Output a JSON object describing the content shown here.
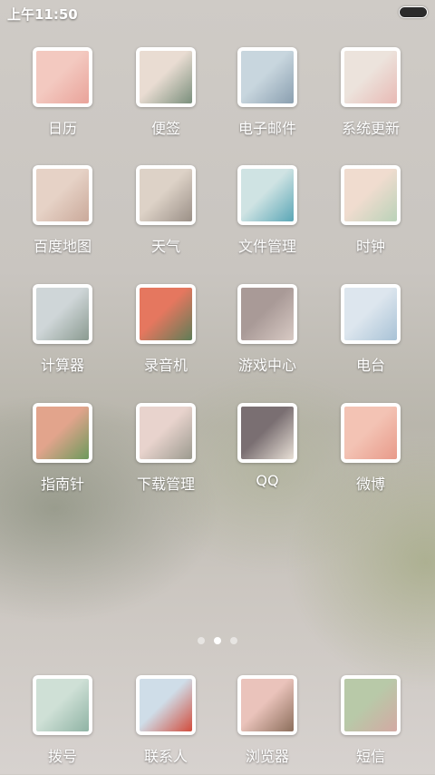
{
  "status_bar": {
    "time": "上午11:50"
  },
  "apps": [
    {
      "label": "日历",
      "icon": "calendar-icon",
      "colors": [
        "#f3c9c0",
        "#e9a39a"
      ]
    },
    {
      "label": "便签",
      "icon": "notes-icon",
      "colors": [
        "#e9dcd2",
        "#7a8f7c"
      ]
    },
    {
      "label": "电子邮件",
      "icon": "email-icon",
      "colors": [
        "#c8d6de",
        "#8a9fb0"
      ]
    },
    {
      "label": "系统更新",
      "icon": "system-update-icon",
      "colors": [
        "#ece3dc",
        "#e8b9b4"
      ]
    },
    {
      "label": "百度地图",
      "icon": "map-icon",
      "colors": [
        "#e6d2c6",
        "#caa99a"
      ]
    },
    {
      "label": "天气",
      "icon": "weather-icon",
      "colors": [
        "#ddd2c7",
        "#9a8f86"
      ]
    },
    {
      "label": "文件管理",
      "icon": "file-manager-icon",
      "colors": [
        "#cfe3e3",
        "#5aa6b6"
      ]
    },
    {
      "label": "时钟",
      "icon": "clock-icon",
      "colors": [
        "#f0dccf",
        "#b9d2b8"
      ]
    },
    {
      "label": "计算器",
      "icon": "calculator-icon",
      "colors": [
        "#cfd6d8",
        "#8a9a90"
      ]
    },
    {
      "label": "录音机",
      "icon": "recorder-icon",
      "colors": [
        "#e5775f",
        "#5e7d57"
      ]
    },
    {
      "label": "游戏中心",
      "icon": "game-center-icon",
      "colors": [
        "#a99a97",
        "#d8cac4"
      ]
    },
    {
      "label": "电台",
      "icon": "radio-icon",
      "colors": [
        "#dde6ee",
        "#a8c2d6"
      ]
    },
    {
      "label": "指南针",
      "icon": "compass-icon",
      "colors": [
        "#e2a48c",
        "#6c9a5c"
      ]
    },
    {
      "label": "下载管理",
      "icon": "download-manager-icon",
      "colors": [
        "#e8d3cd",
        "#9b9a8e"
      ]
    },
    {
      "label": "QQ",
      "icon": "qq-icon",
      "colors": [
        "#7a6f72",
        "#e8e0d6"
      ]
    },
    {
      "label": "微博",
      "icon": "weibo-icon",
      "colors": [
        "#f3c3b4",
        "#e89a8a"
      ]
    }
  ],
  "page_indicator": {
    "count": 3,
    "active": 2
  },
  "dock": [
    {
      "label": "拨号",
      "icon": "phone-icon",
      "colors": [
        "#cfe0d6",
        "#8fb3a4"
      ]
    },
    {
      "label": "联系人",
      "icon": "contacts-icon",
      "colors": [
        "#cfdde8",
        "#d24c3c"
      ]
    },
    {
      "label": "浏览器",
      "icon": "browser-icon",
      "colors": [
        "#eac3bb",
        "#8c6e5b"
      ]
    },
    {
      "label": "短信",
      "icon": "messages-icon",
      "colors": [
        "#b8c9a8",
        "#d3a9a3"
      ]
    }
  ]
}
